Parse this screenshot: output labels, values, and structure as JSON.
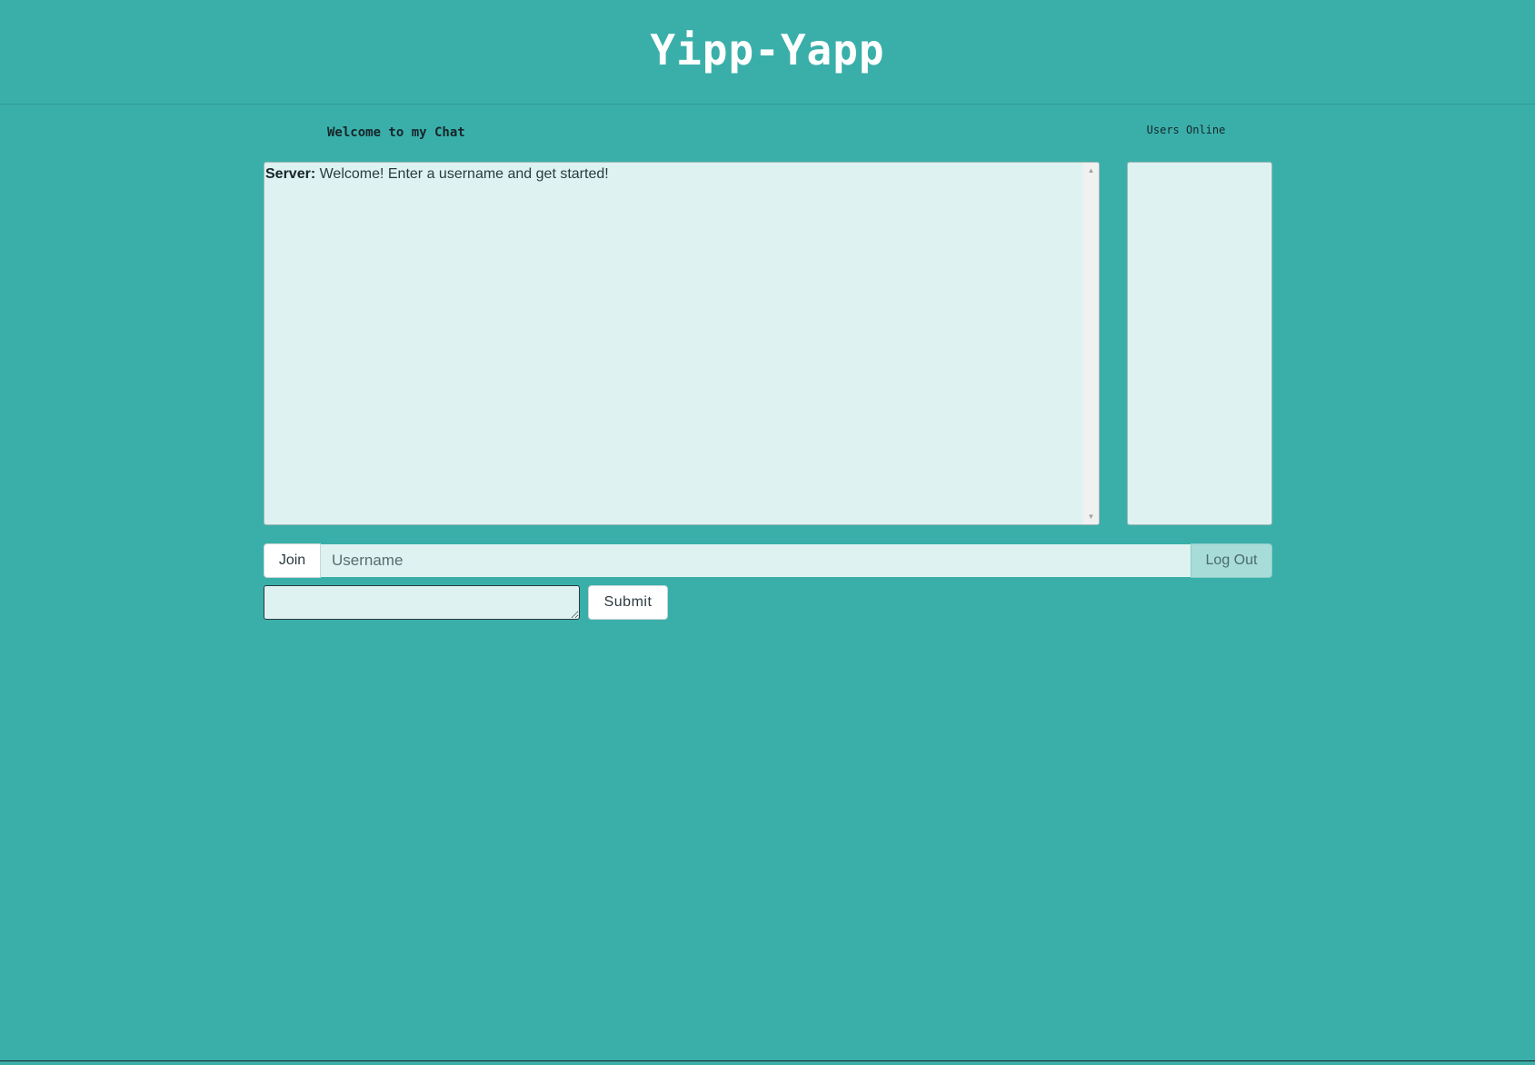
{
  "header": {
    "title": "Yipp-Yapp"
  },
  "chat": {
    "heading": "Welcome to my Chat",
    "messages": [
      {
        "sender": "Server:",
        "text": " Welcome! Enter a username and get started!"
      }
    ]
  },
  "users": {
    "heading": "Users Online",
    "list": []
  },
  "join_form": {
    "join_label": "Join",
    "username_placeholder": "Username",
    "username_value": "",
    "logout_label": "Log Out"
  },
  "message_form": {
    "message_value": "",
    "submit_label": "Submit"
  },
  "colors": {
    "background": "#3aafa9",
    "panel": "#def2f1",
    "text_dark": "#17252a",
    "title": "#ffffff",
    "logout_bg": "#a8dcd9"
  },
  "icons": {
    "scroll_up": "triangle-up-icon",
    "scroll_down": "triangle-down-icon"
  }
}
